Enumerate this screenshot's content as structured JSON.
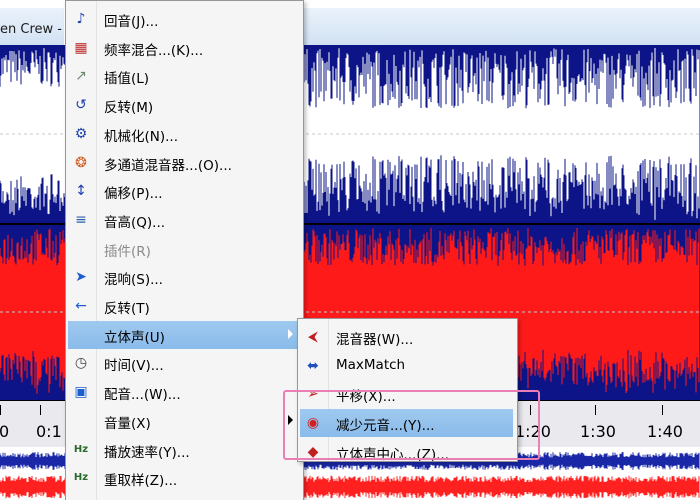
{
  "window": {
    "title_fragment": "en Crew -"
  },
  "colors": {
    "wave_bg": "#0d1487",
    "wave_bg2": "#0a0f70",
    "ch1_wave": "#ffffff",
    "ch2_wave": "#ff1a1a",
    "overview_blue": "#1a28a8",
    "overview_red": "#ff2020",
    "highlight": "#c1dcf6",
    "annotation": "#e97fb4"
  },
  "ruler": {
    "labels": [
      "0",
      "0:1",
      "1:20",
      "1:30",
      "1:40"
    ]
  },
  "effects_menu": {
    "items": [
      {
        "label": "回音(J)...",
        "icon": "echo-icon",
        "enabled": true
      },
      {
        "label": "频率混合...(K)...",
        "icon": "frequency-mix-icon",
        "enabled": true
      },
      {
        "label": "插值(L)",
        "icon": "interpolate-icon",
        "enabled": true
      },
      {
        "label": "反转(M)",
        "icon": "invert-icon",
        "enabled": true
      },
      {
        "label": "机械化(N)...",
        "icon": "mechanize-icon",
        "enabled": true
      },
      {
        "label": "多通道混音器...(O)...",
        "icon": "multichannel-mixer-icon",
        "enabled": true
      },
      {
        "label": "偏移(P)...",
        "icon": "offset-icon",
        "enabled": true
      },
      {
        "label": "音高(Q)...",
        "icon": "pitch-icon",
        "enabled": true
      },
      {
        "label": "插件(R)",
        "icon": "",
        "enabled": false
      },
      {
        "label": "混响(S)...",
        "icon": "reverb-icon",
        "enabled": true
      },
      {
        "label": "反转(T)",
        "icon": "reverse-icon",
        "enabled": true
      },
      {
        "label": "立体声(U)",
        "icon": "",
        "enabled": true,
        "submenu": true,
        "highlighted": true
      },
      {
        "label": "时间(V)...",
        "icon": "clock-icon",
        "enabled": true
      },
      {
        "label": "配音...(W)...",
        "icon": "dubbing-icon",
        "enabled": true
      },
      {
        "label": "音量(X)",
        "icon": "",
        "enabled": true,
        "submenu": true
      },
      {
        "label": "播放速率(Y)...",
        "icon": "playback-rate-icon",
        "enabled": true
      },
      {
        "label": "重取样(Z)...",
        "icon": "resample-icon",
        "enabled": true
      }
    ]
  },
  "stereo_submenu": {
    "items": [
      {
        "label": "混音器(W)...",
        "icon": "mixer-icon",
        "highlighted": false
      },
      {
        "label": "MaxMatch",
        "icon": "maxmatch-icon",
        "highlighted": false
      },
      {
        "label": "平移(X)...",
        "icon": "pan-icon",
        "highlighted": false
      },
      {
        "label": "减少元音...(Y)...",
        "icon": "vocal-reduce-icon",
        "highlighted": true
      },
      {
        "label": "立体声中心...(Z)...",
        "icon": "stereo-center-icon",
        "highlighted": false
      }
    ]
  }
}
